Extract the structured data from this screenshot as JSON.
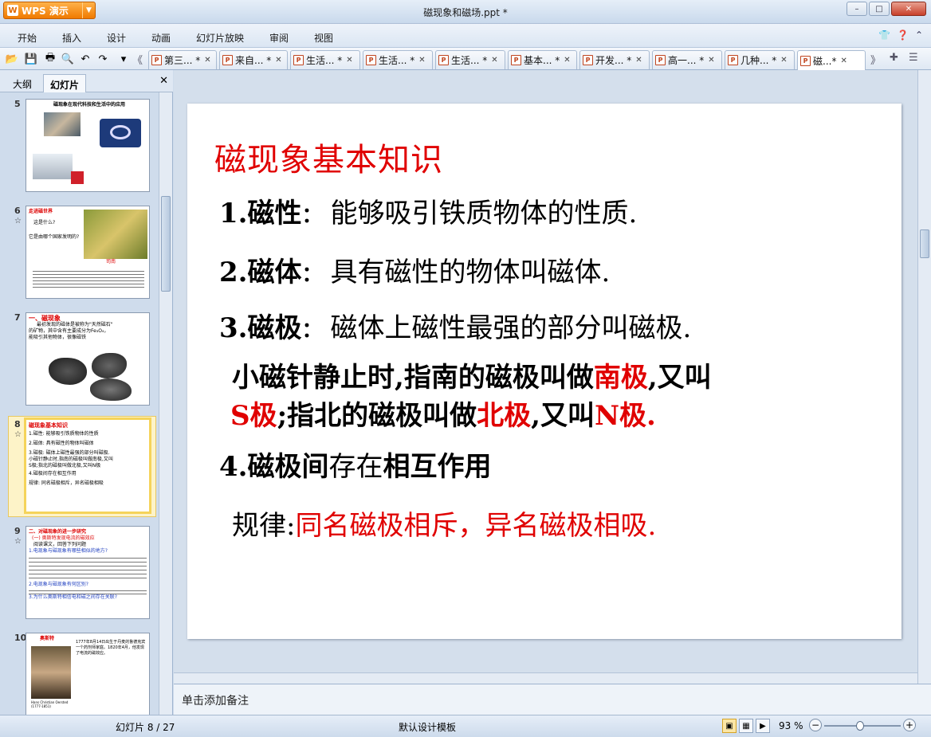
{
  "app": {
    "name": "WPS 演示",
    "doc_title": "磁现象和磁场.ppt *"
  },
  "window_controls": {
    "minimize": "–",
    "maximize": "□",
    "close": "✕"
  },
  "menu": {
    "items": [
      "开始",
      "插入",
      "设计",
      "动画",
      "幻灯片放映",
      "审阅",
      "视图"
    ]
  },
  "tabs": [
    {
      "label": "第三... *",
      "active": false
    },
    {
      "label": "来自... *",
      "active": false
    },
    {
      "label": "生活... *",
      "active": false
    },
    {
      "label": "生活... *",
      "active": false
    },
    {
      "label": "生活... *",
      "active": false
    },
    {
      "label": "基本... *",
      "active": false
    },
    {
      "label": "开发... *",
      "active": false
    },
    {
      "label": "高一... *",
      "active": false
    },
    {
      "label": "几种... *",
      "active": false
    },
    {
      "label": "磁...*",
      "active": true
    }
  ],
  "left_panel": {
    "tabs": [
      "大纲",
      "幻灯片"
    ],
    "active_tab": "幻灯片",
    "slides": [
      {
        "num": "5",
        "title": "磁现象在现代科技和生活中的应用"
      },
      {
        "num": "6",
        "title": "走进磁世界",
        "line1": "这是什么?",
        "line2": "它是由哪个国家发明的?",
        "caption": "司南"
      },
      {
        "num": "7",
        "title": "一、磁现象",
        "line1": "最初发现的磁体是被称为\"天然磁石\"",
        "line2": "的矿物，其中含有主要成分为Fe₃O₄，",
        "line3": "能吸引其他物体，很像磁铁"
      },
      {
        "num": "8",
        "title": "磁现象基本知识",
        "l1": "1.磁性: 能够吸引铁质物体的性质",
        "l2": "2.磁体: 具有磁性的物体叫磁体",
        "l3": "3.磁极: 磁体上磁性最强的部分叫磁极.",
        "l4": "小磁针静止时,指南的磁极叫做南极,又叫",
        "l5": "S极;指北的磁极叫做北极,又叫N极",
        "l6": "4.磁极间存在相互作用",
        "l7": "规律: 同名磁极相斥，异名磁极相吸"
      },
      {
        "num": "9",
        "title": "二、对磁现象的进一步研究",
        "sub": "(一) 奥斯特发现电流的磁效应",
        "l1": "阅读课文，回答下列问题",
        "l2": "1.电现象与磁现象有哪些相似的地方?",
        "l3": "2.电现象与磁现象有何区别?",
        "l4": "3.为什么奥斯特相信电和磁之间存在关联?"
      },
      {
        "num": "10",
        "title": "奥斯特",
        "text": "1777年8月14日出生于丹麦的鲁德克宾一个药剂师家庭。1820年4月，他发现了电流的磁效应。",
        "caption": "Hans Christian Oersted (1777-1851)"
      }
    ]
  },
  "slide": {
    "title": "磁现象基本知识",
    "l1_head": "1.磁性",
    "l1_colon": "：",
    "l1_text": "能够吸引铁质物体的性质.",
    "l2_head": "2.磁体",
    "l2_colon": "：",
    "l2_text": "具有磁性的物体叫磁体.",
    "l3_head": "3.磁极",
    "l3_colon": "：",
    "l3_text": "磁体上磁性最强的部分叫磁极.",
    "l4a": "小磁针静止时,指南的磁极叫做",
    "l4b": "南极",
    "l4c": ",又叫",
    "l5a": "S极",
    "l5b": ";指北的磁极叫做",
    "l5c": "北极",
    "l5d": ",又叫",
    "l5e": "N极.",
    "l6a": "4.磁极间",
    "l6b": "存在",
    "l6c": "相互作用",
    "l7a": "规律:",
    "l7b": "同名磁极相斥，异名磁极相吸.",
    "accent_color": "#e00000"
  },
  "notes_placeholder": "单击添加备注",
  "status": {
    "slide_info": "幻灯片 8 / 27",
    "template": "默认设计模板",
    "zoom": "93 %"
  },
  "zoom_level": 0.93
}
